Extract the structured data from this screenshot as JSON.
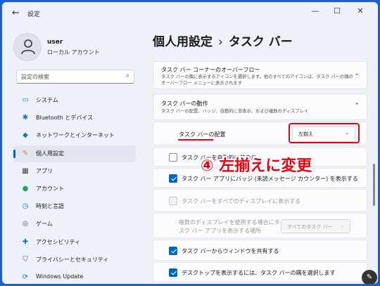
{
  "window": {
    "app_title": "設定",
    "back_icon": "←",
    "minimize": "—",
    "maximize": "☐",
    "close": "✕"
  },
  "user": {
    "name": "user",
    "account_type": "ローカル アカウント"
  },
  "search": {
    "placeholder": "設定の検索",
    "icon": "⌕"
  },
  "nav": {
    "items": [
      {
        "label": "システム",
        "icon": "▭",
        "color": "#1f6fc5"
      },
      {
        "label": "Bluetooth とデバイス",
        "icon": "✱",
        "color": "#1f6fc5"
      },
      {
        "label": "ネットワークとインターネット",
        "icon": "◆",
        "color": "#1f6fc5"
      },
      {
        "label": "個人用設定",
        "icon": "✎",
        "color": "#c48a2c"
      },
      {
        "label": "アプリ",
        "icon": "▦",
        "color": "#444"
      },
      {
        "label": "アカウント",
        "icon": "●",
        "color": "#2c9c6a"
      },
      {
        "label": "時刻と言語",
        "icon": "◷",
        "color": "#1f6fc5"
      },
      {
        "label": "ゲーム",
        "icon": "◎",
        "color": "#555"
      },
      {
        "label": "アクセシビリティ",
        "icon": "✚",
        "color": "#1f6fc5"
      },
      {
        "label": "プライバシーとセキュリティ",
        "icon": "⛉",
        "color": "#555"
      },
      {
        "label": "Windows Update",
        "icon": "⟳",
        "color": "#1f6fc5"
      }
    ],
    "active_index": 3
  },
  "breadcrumb": {
    "parent": "個人用設定",
    "separator": "›",
    "current": "タスク バー"
  },
  "overflow_card": {
    "title": "タスク バー コーナーのオーバーフロー",
    "desc_line1": "タスク バーの隅に表示するアイコンを選択します。他のすべてのアイコンは、タスク バーの隅の",
    "desc_line2": "オーバーフロー メニューに表示されます",
    "chevron": "⌄"
  },
  "behavior_card": {
    "title": "タスク バーの動作",
    "desc": "タスク バーの配置、バッジ、自動的に非表示、および複数のディスプレイ",
    "chevron": "⌃"
  },
  "settings": {
    "alignment_label": "タスク バーの配置",
    "alignment_value": "左揃え",
    "autohide_label": "タスク バーを自動的に非表示",
    "badges_label": "タスク バー アプリにバッジ (未読メッセージ カウンター) を表示する",
    "all_displays_label": "タスク バーをすべてのディスプレイに表示する",
    "multi_display_line1": "複数のディスプレイを使用する場合にタ",
    "multi_display_line2": "スク バー アプリを表示する場所",
    "multi_display_value": "すべてのタスク バー",
    "share_window_label": "タスク バーからウィンドウを共有する",
    "desktop_corner_label": "デスクトップを表示するには、タスク バーの隅を選択します",
    "dropdown_arrow": "⌄"
  },
  "annotation": {
    "text": "④ 左揃えに変更",
    "color": "#e60012"
  },
  "fab_icon": "✎"
}
